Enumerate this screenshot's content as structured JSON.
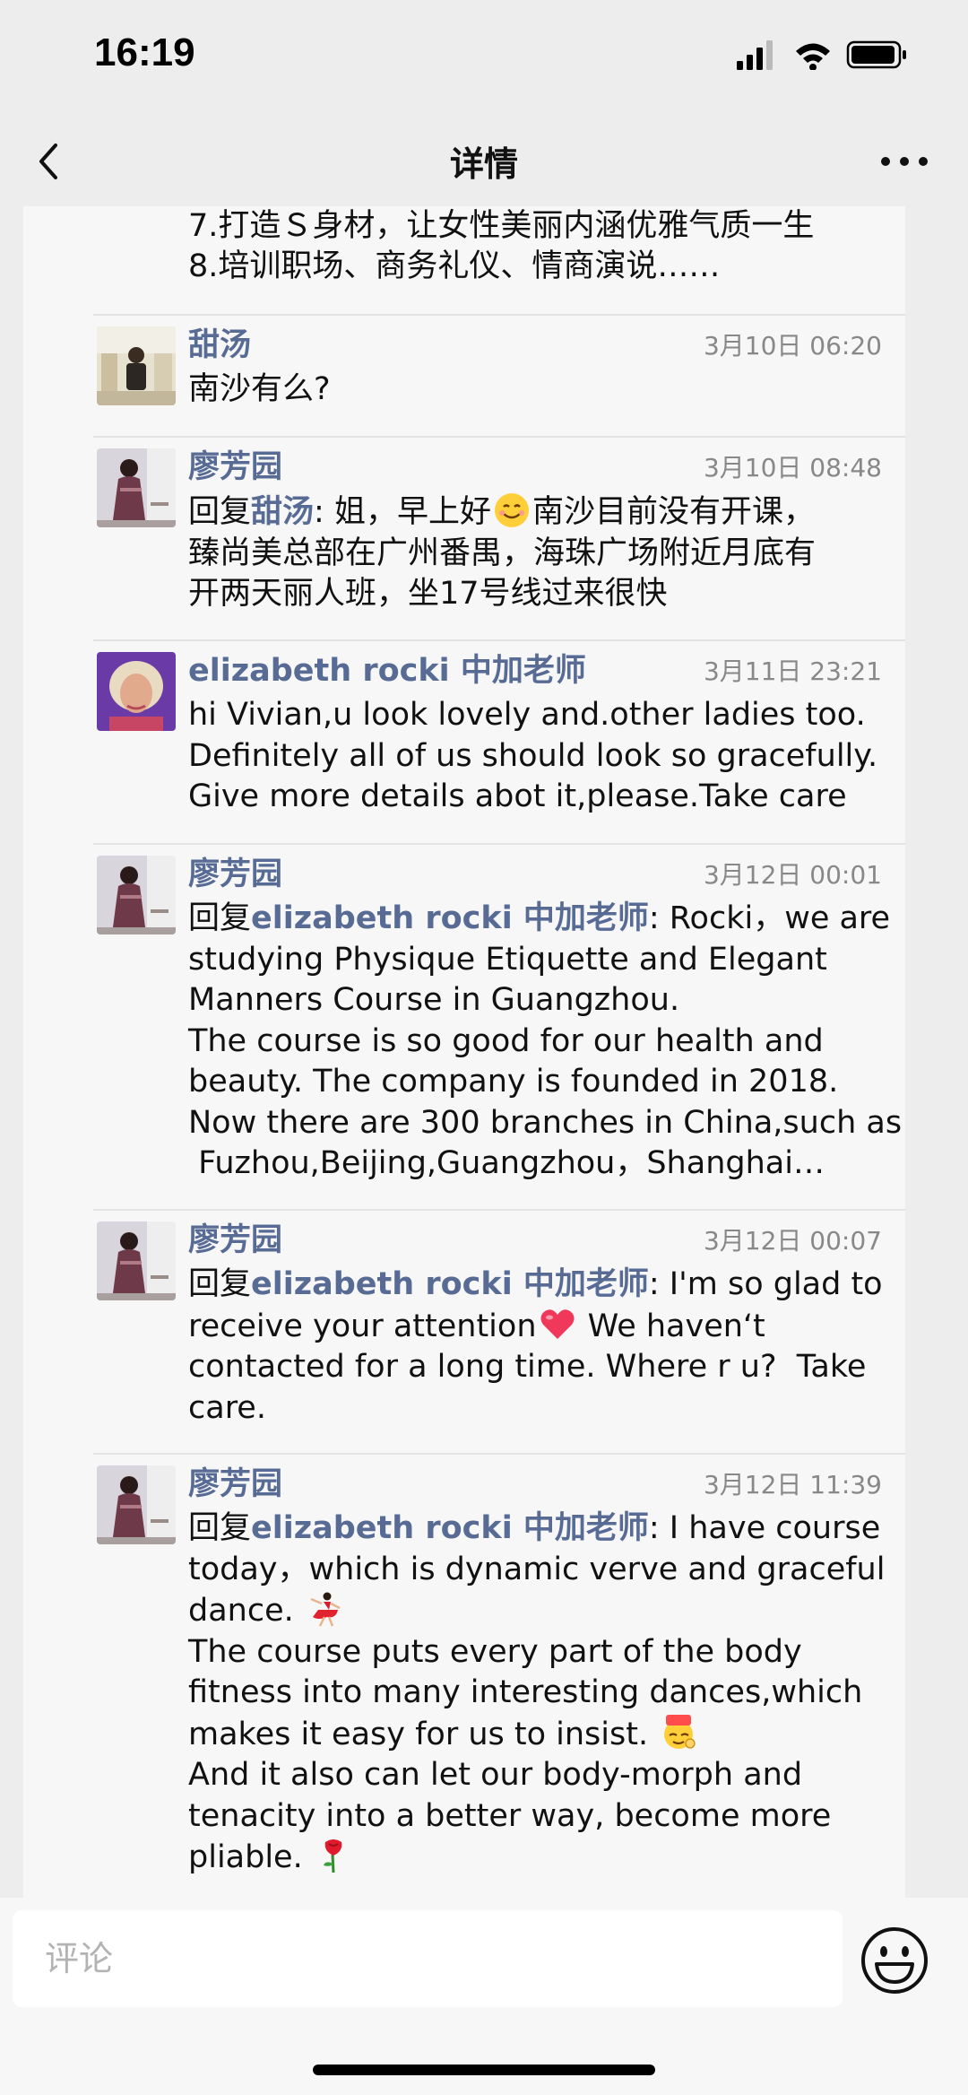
{
  "status_bar": {
    "time": "16:19"
  },
  "nav": {
    "title": "详情"
  },
  "intro_lines": [
    "7.打造Ｓ身材，让女性美丽内涵优雅气质一生",
    "8.培训职场、商务礼仪、情商演说……"
  ],
  "comments": [
    {
      "name": "甜汤",
      "time": "3月10日 06:20",
      "lines": [
        "南沙有么?"
      ]
    },
    {
      "name": "廖芳园",
      "time": "3月10日 08:48",
      "reply_prefix": "回复",
      "reply_to": "甜汤",
      "first_rest_a": ": 姐，早上好",
      "first_rest_b": "南沙目前没有开课，",
      "lines": [
        "臻尚美总部在广州番禺，海珠广场附近月底有",
        "开两天丽人班，坐17号线过来很快"
      ]
    },
    {
      "name": "elizabeth rocki 中加老师",
      "time": "3月11日 23:21",
      "lines": [
        "hi Vivian,u look lovely and.other ladies too.",
        "Definitely all of us should look so gracefully.",
        "Give more details abot it,please.Take care"
      ]
    },
    {
      "name": "廖芳园",
      "time": "3月12日 00:01",
      "reply_prefix": "回复",
      "reply_to": "elizabeth rocki 中加老师",
      "first_rest": ": Rocki，we are",
      "lines": [
        "studying Physique Etiquette and Elegant",
        "Manners Course in Guangzhou.",
        "The course is so good for our health and",
        "beauty. The company is founded in 2018.",
        "Now there are 300 branches in China,such as",
        " Fuzhou,Beijing,Guangzhou，Shanghai…"
      ]
    },
    {
      "name": "廖芳园",
      "time": "3月12日 00:07",
      "reply_prefix": "回复",
      "reply_to": "elizabeth rocki 中加老师",
      "first_rest": ": I'm so glad to",
      "line2_a": "receive your attention",
      "line2_b": " We haven‘t",
      "lines": [
        "contacted for a long time. Where r u?  Take",
        "care."
      ]
    },
    {
      "name": "廖芳园",
      "time": "3月12日 11:39",
      "reply_prefix": "回复",
      "reply_to": "elizabeth rocki 中加老师",
      "first_rest": ": I have course",
      "line2": "today，which is dynamic verve and graceful",
      "line3": "dance. ",
      "line4": "The course puts every part of the body",
      "line5": "fitness into many interesting dances,which",
      "line6": "makes it easy for us to insist. ",
      "line7": "And it also can let our body-morph and",
      "line8": "tenacity into a better way, become more",
      "line9": "pliable. "
    }
  ],
  "comment_bar": {
    "placeholder": "评论"
  },
  "icons": {
    "back": "chevron-left-icon",
    "more": "more-dots-icon",
    "emoji": "smiley-icon",
    "inline": [
      "smile-emoji",
      "heart-emoji",
      "dancer-emoji",
      "666-emoji",
      "rose-emoji"
    ]
  },
  "colors": {
    "link": "#576b95",
    "background": "#ededed",
    "panel": "#f7f7f7"
  }
}
